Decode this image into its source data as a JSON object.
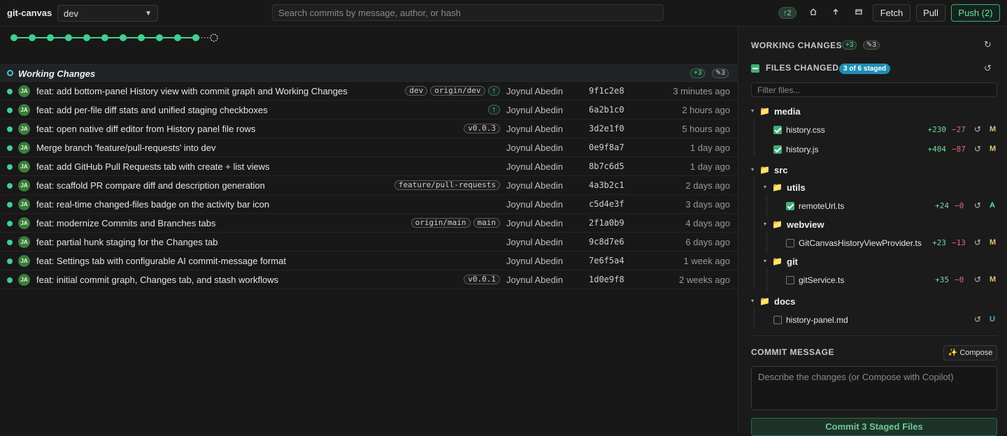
{
  "header": {
    "app_title": "git-canvas",
    "branch": "dev",
    "search_placeholder": "Search commits by message, author, or hash",
    "ahead_badge": "↑2",
    "fetch_label": "Fetch",
    "pull_label": "Pull",
    "push_label": "Push (2)"
  },
  "working_changes": {
    "title": "Working Changes",
    "added": "+3",
    "modified": "✎3"
  },
  "commits": [
    {
      "message": "feat: add bottom-panel History view with commit graph and Working Changes",
      "tags": [
        "dev",
        "origin/dev",
        "↑"
      ],
      "author": "Joynul Abedin",
      "hash": "9f1c2e8",
      "date": "3 minutes ago"
    },
    {
      "message": "feat: add per-file diff stats and unified staging checkboxes",
      "tags": [
        "↑"
      ],
      "author": "Joynul Abedin",
      "hash": "6a2b1c0",
      "date": "2 hours ago"
    },
    {
      "message": "feat: open native diff editor from History panel file rows",
      "tags": [
        "v0.0.3"
      ],
      "author": "Joynul Abedin",
      "hash": "3d2e1f0",
      "date": "5 hours ago"
    },
    {
      "message": "Merge branch 'feature/pull-requests' into dev",
      "tags": [],
      "author": "Joynul Abedin",
      "hash": "0e9f8a7",
      "date": "1 day ago"
    },
    {
      "message": "feat: add GitHub Pull Requests tab with create + list views",
      "tags": [],
      "author": "Joynul Abedin",
      "hash": "8b7c6d5",
      "date": "1 day ago"
    },
    {
      "message": "feat: scaffold PR compare diff and description generation",
      "tags": [
        "feature/pull-requests"
      ],
      "author": "Joynul Abedin",
      "hash": "4a3b2c1",
      "date": "2 days ago"
    },
    {
      "message": "feat: real-time changed-files badge on the activity bar icon",
      "tags": [],
      "author": "Joynul Abedin",
      "hash": "c5d4e3f",
      "date": "3 days ago"
    },
    {
      "message": "feat: modernize Commits and Branches tabs",
      "tags": [
        "origin/main",
        "main"
      ],
      "author": "Joynul Abedin",
      "hash": "2f1a0b9",
      "date": "4 days ago"
    },
    {
      "message": "feat: partial hunk staging for the Changes tab",
      "tags": [],
      "author": "Joynul Abedin",
      "hash": "9c8d7e6",
      "date": "6 days ago"
    },
    {
      "message": "feat: Settings tab with configurable AI commit-message format",
      "tags": [],
      "author": "Joynul Abedin",
      "hash": "7e6f5a4",
      "date": "1 week ago"
    },
    {
      "message": "feat: initial commit graph, Changes tab, and stash workflows",
      "tags": [
        "v0.0.1"
      ],
      "author": "Joynul Abedin",
      "hash": "1d0e9f8",
      "date": "2 weeks ago"
    }
  ],
  "avatar_initials": "JA",
  "panel": {
    "working_title": "WORKING CHANGES",
    "working_added": "+3",
    "working_modified": "✎3",
    "files_title": "FILES CHANGED",
    "staged_badge": "3 of 6 staged",
    "filter_placeholder": "Filter files...",
    "commit_title": "COMMIT MESSAGE",
    "compose_label": "✨ Compose",
    "commit_placeholder": "Describe the changes (or Compose with Copilot)",
    "commit_button": "Commit 3 Staged Files"
  },
  "tree": [
    {
      "type": "dir",
      "name": "media",
      "depth": 0
    },
    {
      "type": "file",
      "name": "history.css",
      "depth": 1,
      "checked": true,
      "adds": "+230",
      "dels": "−27",
      "status": "M"
    },
    {
      "type": "file",
      "name": "history.js",
      "depth": 1,
      "checked": true,
      "adds": "+404",
      "dels": "−87",
      "status": "M"
    },
    {
      "type": "dir",
      "name": "src",
      "depth": 0
    },
    {
      "type": "dir",
      "name": "utils",
      "depth": 1
    },
    {
      "type": "file",
      "name": "remoteUrl.ts",
      "depth": 2,
      "checked": true,
      "adds": "+24",
      "dels": "−0",
      "status": "A"
    },
    {
      "type": "dir",
      "name": "webview",
      "depth": 1
    },
    {
      "type": "file",
      "name": "GitCanvasHistoryViewProvider.ts",
      "depth": 2,
      "checked": false,
      "adds": "+23",
      "dels": "−13",
      "status": "M"
    },
    {
      "type": "dir",
      "name": "git",
      "depth": 1
    },
    {
      "type": "file",
      "name": "gitService.ts",
      "depth": 2,
      "checked": false,
      "adds": "+35",
      "dels": "−0",
      "status": "M"
    },
    {
      "type": "dir",
      "name": "docs",
      "depth": 0
    },
    {
      "type": "file",
      "name": "history-panel.md",
      "depth": 1,
      "checked": false,
      "adds": "",
      "dels": "",
      "status": "U"
    }
  ],
  "colors": {
    "accent": "#3fd18e",
    "status_M": "#e5c07b",
    "status_A": "#6fdc9f",
    "status_U": "#4fb3e8"
  },
  "graph_nodes": 11
}
